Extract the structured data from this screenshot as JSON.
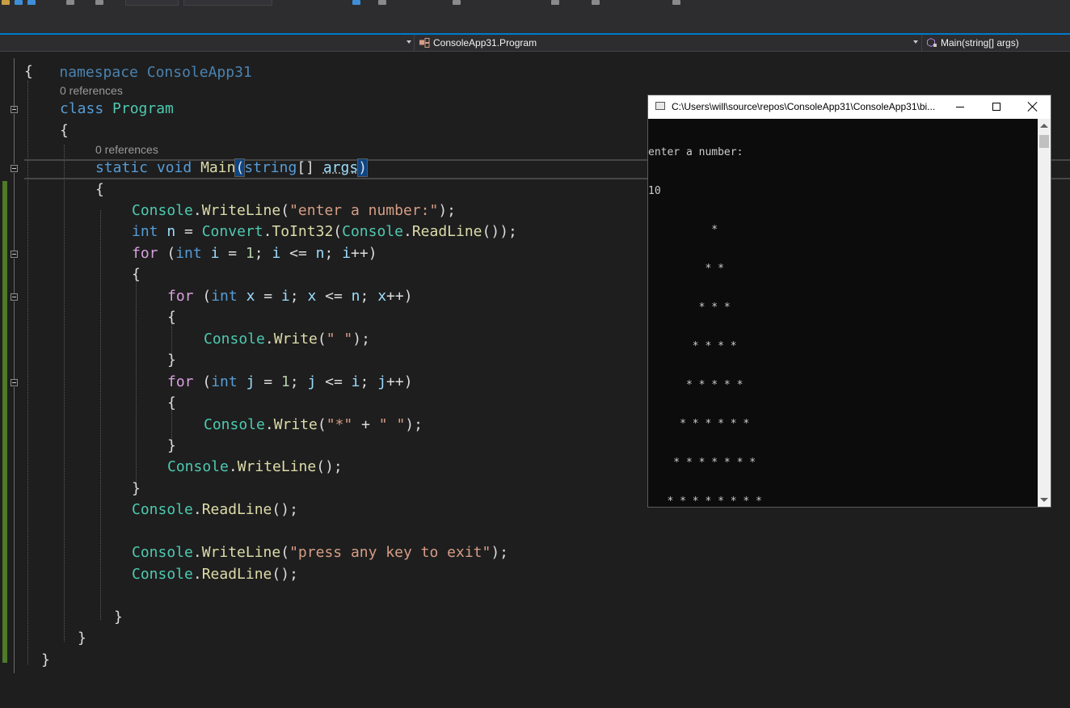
{
  "navbar": {
    "project_class": "ConsoleApp31.Program",
    "member": "Main(string[] args)"
  },
  "editor": {
    "partial_top_line": "namespace ConsoleApp31",
    "codelens_class": "0 references",
    "codelens_method": "0 references",
    "lines": {
      "ns_open": "{",
      "class_kw": "class",
      "class_name": "Program",
      "class_open": "{",
      "static_kw": "static",
      "void_kw": "void",
      "method_name": "Main",
      "param_type": "string",
      "param_brackets": "[]",
      "param_name": "args",
      "method_open": "{",
      "wl1_prefix": "Console",
      "wl1_method": "WriteLine",
      "wl1_str": "\"enter a number:\"",
      "int_kw": "int",
      "n_var": "n",
      "convert_type": "Convert",
      "toint": "ToInt32",
      "rl_type": "Console",
      "rl_method": "ReadLine",
      "for1_kw": "for",
      "for1_int": "int",
      "for1_cond": "i",
      "for1_open": "{",
      "for2_kw": "for",
      "for2_int": "int",
      "for2_body_type": "Console",
      "for2_body_method": "Write",
      "for2_body_str": "\" \"",
      "for2_open": "{",
      "for2_close": "}",
      "for3_kw": "for",
      "for3_int": "int",
      "for3_body_type": "Console",
      "for3_body_method": "Write",
      "for3_str1": "\"*\"",
      "for3_str2": "\" \"",
      "for3_open": "{",
      "for3_close": "}",
      "wl2_type": "Console",
      "wl2_method": "WriteLine",
      "for1_close": "}",
      "rl2_type": "Console",
      "rl2_method": "ReadLine",
      "wl3_type": "Console",
      "wl3_method": "WriteLine",
      "wl3_str": "\"press any key to exit\"",
      "rl3_type": "Console",
      "rl3_method": "ReadLine",
      "method_close": "}",
      "class_close": "}",
      "ns_close": "}"
    }
  },
  "console": {
    "title": "C:\\Users\\will\\source\\repos\\ConsoleApp31\\ConsoleApp31\\bi...",
    "output": [
      "enter a number:",
      "10",
      "          * ",
      "         * * ",
      "        * * * ",
      "       * * * * ",
      "      * * * * * ",
      "     * * * * * * ",
      "    * * * * * * * ",
      "   * * * * * * * * ",
      "  * * * * * * * * * ",
      " * * * * * * * * * * "
    ]
  },
  "colors": {
    "editor_bg": "#1e1e1e",
    "keyword": "#569cd6",
    "control": "#d8a0df",
    "type": "#4ec9b0",
    "method": "#dcdcaa",
    "string": "#d69d85",
    "accent": "#007acc"
  }
}
